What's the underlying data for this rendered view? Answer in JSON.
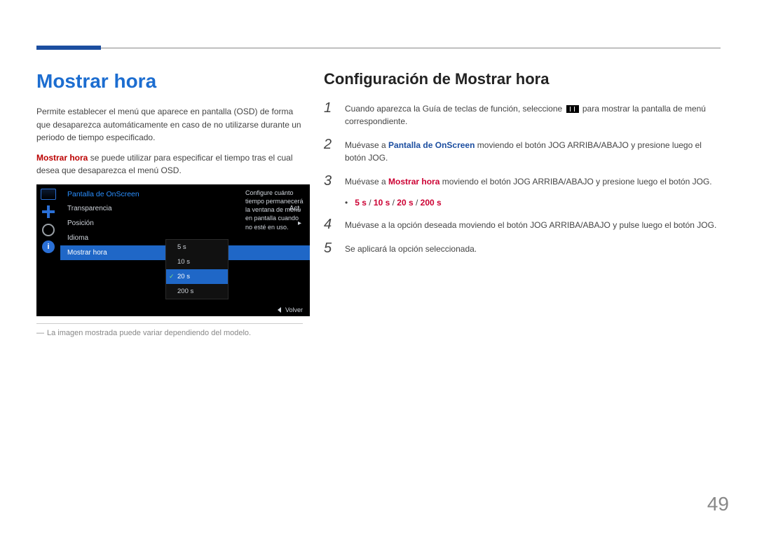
{
  "page_number": "49",
  "left": {
    "heading": "Mostrar hora",
    "para1": "Permite establecer el menú que aparece en pantalla (OSD) de forma que desaparezca automáticamente en caso de no utilizarse durante un periodo de tiempo especificado.",
    "para2_strong": "Mostrar hora",
    "para2_rest": " se puede utilizar para especificar el tiempo tras el cual desea que desaparezca el menú OSD.",
    "footnote_dash": "―",
    "footnote": "La imagen mostrada puede variar dependiendo del modelo."
  },
  "osd": {
    "title": "Pantalla de OnScreen",
    "rows": [
      {
        "label": "Transparencia",
        "value": "Act."
      },
      {
        "label": "Posición",
        "value": "▸"
      },
      {
        "label": "Idioma",
        "value": ""
      },
      {
        "label": "Mostrar hora",
        "value": ""
      }
    ],
    "dropdown": [
      "5 s",
      "10 s",
      "20 s",
      "200 s"
    ],
    "dropdown_selected_index": 2,
    "tip": "Configure cuánto tiempo permanecerá la ventana de menú en pantalla cuando no esté en uso.",
    "footer": "Volver"
  },
  "right": {
    "heading": "Configuración de Mostrar hora",
    "steps": [
      {
        "n": "1",
        "pre": "Cuando aparezca la Guía de teclas de función, seleccione ",
        "post": " para mostrar la pantalla de menú correspondiente.",
        "icon": true
      },
      {
        "n": "2",
        "pre": "Muévase a ",
        "strong_blue": "Pantalla de OnScreen",
        "post": " moviendo el botón JOG ARRIBA/ABAJO y presione luego el botón JOG."
      },
      {
        "n": "3",
        "pre": "Muévase a ",
        "strong_red": "Mostrar hora",
        "post": " moviendo el botón JOG ARRIBA/ABAJO y presione luego el botón JOG."
      },
      {
        "n": "4",
        "text": "Muévase a la opción deseada moviendo el botón JOG ARRIBA/ABAJO y pulse luego el botón JOG."
      },
      {
        "n": "5",
        "text": "Se aplicará la opción seleccionada."
      }
    ],
    "options": {
      "o1": "5 s",
      "o2": "10 s",
      "o3": "20 s",
      "o4": "200 s",
      "sep": " / "
    }
  }
}
